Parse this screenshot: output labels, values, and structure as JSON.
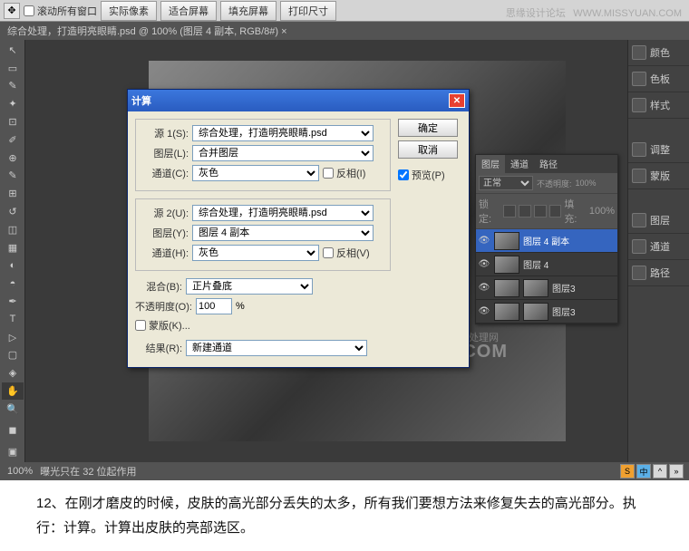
{
  "topbar": {
    "scroll_label": "滚动所有窗口",
    "btns": [
      "实际像素",
      "适合屏幕",
      "填充屏幕",
      "打印尺寸"
    ],
    "site": "思缘设计论坛",
    "url": "WWW.MISSYUAN.COM"
  },
  "doctab": "综合处理，打造明亮眼睛.psd @ 100% (图层 4 副本, RGB/8#) ×",
  "dialog": {
    "title": "计算",
    "ok": "确定",
    "cancel": "取消",
    "preview": "预览(P)",
    "src1_label": "源 1(S):",
    "src1_val": "综合处理，打造明亮眼睛.psd",
    "layer1_label": "图层(L):",
    "layer1_val": "合并图层",
    "chan1_label": "通道(C):",
    "chan1_val": "灰色",
    "inv1": "反相(I)",
    "src2_label": "源 2(U):",
    "src2_val": "综合处理，打造明亮眼睛.psd",
    "layer2_label": "图层(Y):",
    "layer2_val": "图层 4 副本",
    "chan2_label": "通道(H):",
    "chan2_val": "灰色",
    "inv2": "反相(V)",
    "blend_label": "混合(B):",
    "blend_val": "正片叠底",
    "opacity_label": "不透明度(O):",
    "opacity_val": "100",
    "pct": "%",
    "mask": "蒙版(K)...",
    "result_label": "结果(R):",
    "result_val": "新建通道"
  },
  "layers": {
    "tabs": [
      "图层",
      "通道",
      "路径"
    ],
    "mode": "正常",
    "opacity_lbl": "不透明度:",
    "opacity": "100%",
    "lock_lbl": "锁定:",
    "fill_lbl": "填充:",
    "fill": "100%",
    "items": [
      {
        "name": "图层 4 副本",
        "sel": true
      },
      {
        "name": "图层 4",
        "sel": false
      },
      {
        "name": "图层3",
        "sel": false
      },
      {
        "name": "图层3",
        "sel": false
      }
    ]
  },
  "rpanel": {
    "items": [
      "颜色",
      "色板",
      "样式"
    ],
    "items2": [
      "调整",
      "蒙版"
    ],
    "items3": [
      "图层",
      "通道",
      "路径"
    ]
  },
  "status": {
    "zoom": "100%",
    "text": "曝光只在 32 位起作用"
  },
  "watermark": {
    "line1": "www.    照片处理网",
    "line2": "PHOTOPS.COM"
  },
  "caption": "12、在刚才磨皮的时候，皮肤的高光部分丢失的太多，所有我们要想方法来修复失去的高光部分。执行：计算。计算出皮肤的亮部选区。"
}
